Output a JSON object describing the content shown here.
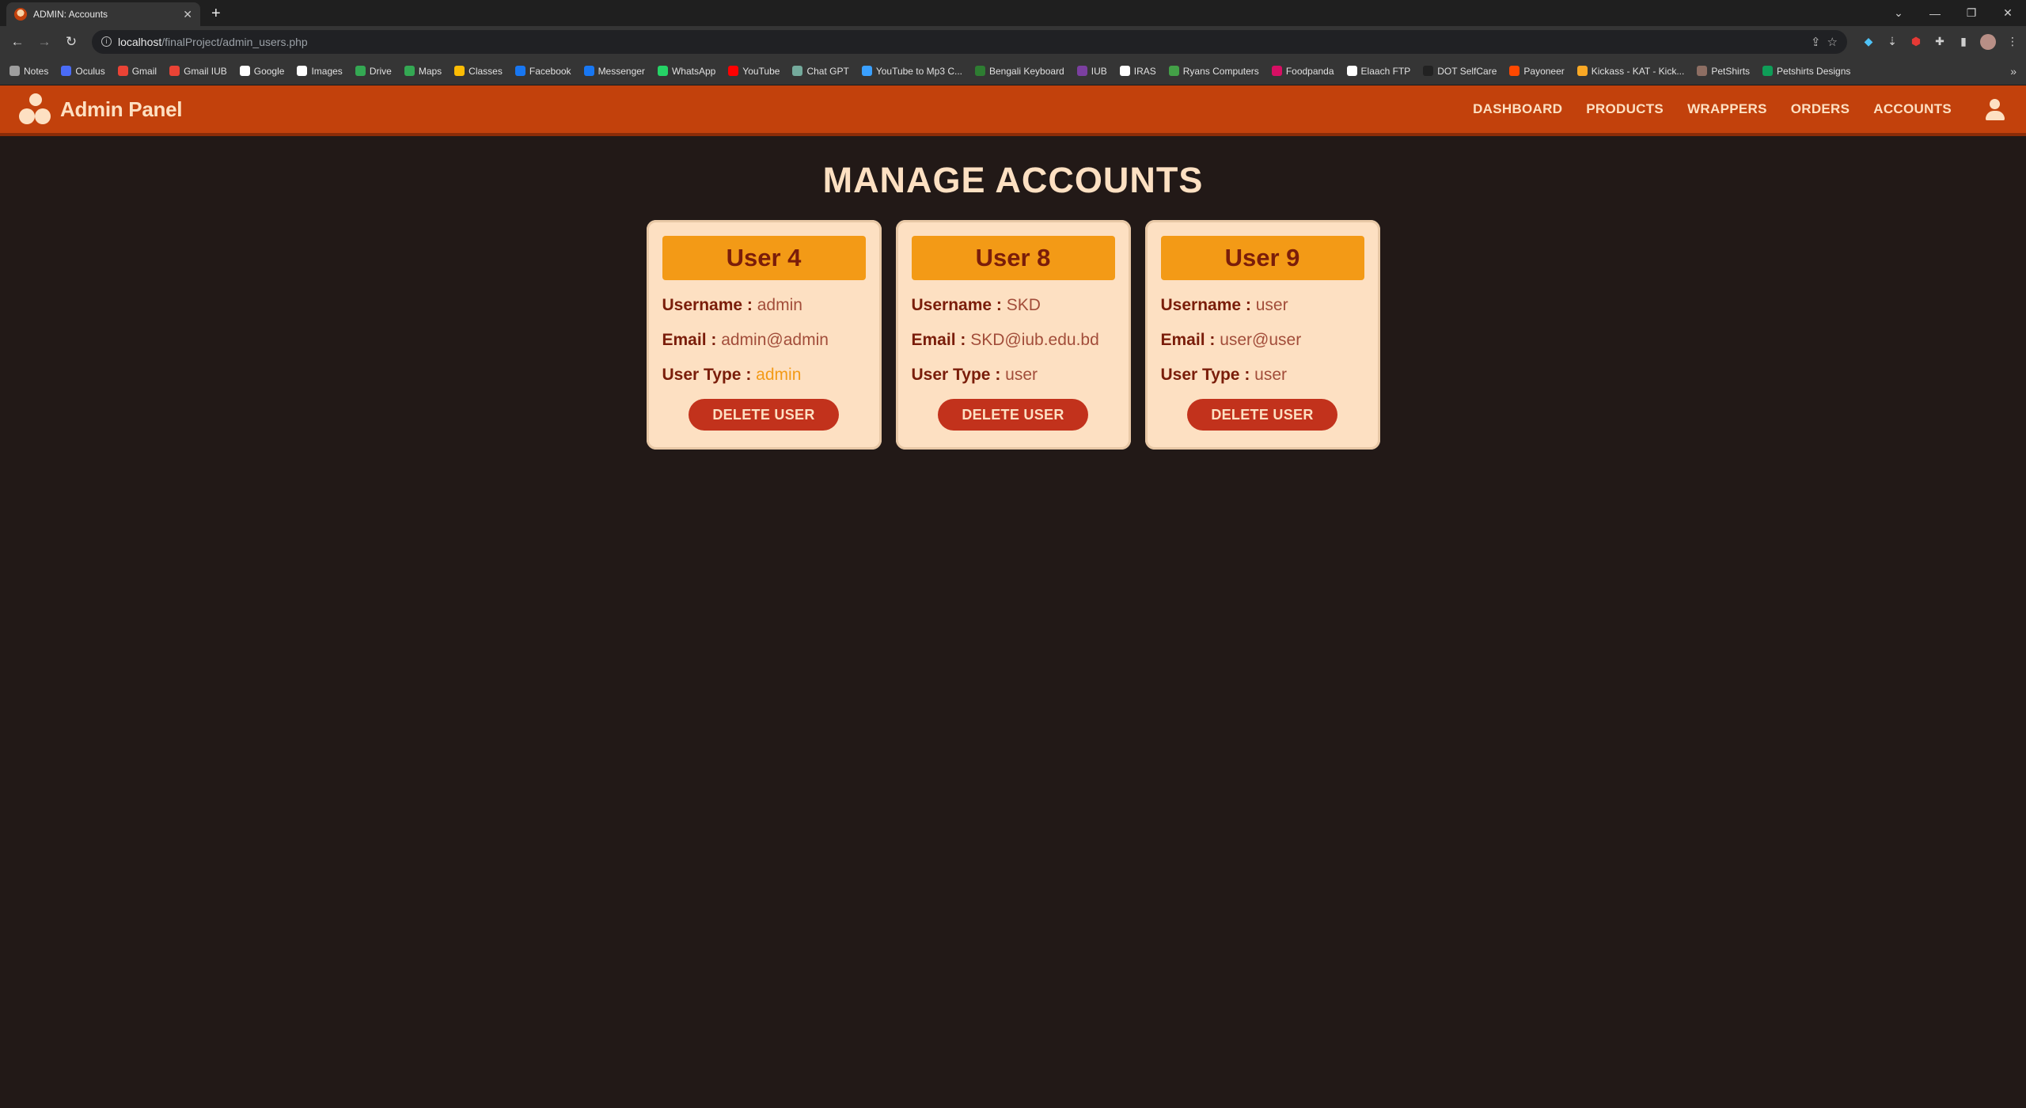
{
  "browser": {
    "tab_title": "ADMIN: Accounts",
    "url_host": "localhost",
    "url_path": "/finalProject/admin_users.php",
    "bookmarks": [
      {
        "label": "Notes",
        "color": "#9e9e9e"
      },
      {
        "label": "Oculus",
        "color": "#4a6cf7"
      },
      {
        "label": "Gmail",
        "color": "#ea4335"
      },
      {
        "label": "Gmail IUB",
        "color": "#ea4335"
      },
      {
        "label": "Google",
        "color": "#ffffff"
      },
      {
        "label": "Images",
        "color": "#ffffff"
      },
      {
        "label": "Drive",
        "color": "#34a853"
      },
      {
        "label": "Maps",
        "color": "#34a853"
      },
      {
        "label": "Classes",
        "color": "#fbbc04"
      },
      {
        "label": "Facebook",
        "color": "#1877f2"
      },
      {
        "label": "Messenger",
        "color": "#1877f2"
      },
      {
        "label": "WhatsApp",
        "color": "#25d366"
      },
      {
        "label": "YouTube",
        "color": "#ff0000"
      },
      {
        "label": "Chat GPT",
        "color": "#74aa9c"
      },
      {
        "label": "YouTube to Mp3 C...",
        "color": "#3aa0ff"
      },
      {
        "label": "Bengali Keyboard",
        "color": "#2e7d32"
      },
      {
        "label": "IUB",
        "color": "#7b3fa0"
      },
      {
        "label": "IRAS",
        "color": "#ffffff"
      },
      {
        "label": "Ryans Computers",
        "color": "#43a047"
      },
      {
        "label": "Foodpanda",
        "color": "#d70f64"
      },
      {
        "label": "Elaach FTP",
        "color": "#ffffff"
      },
      {
        "label": "DOT SelfCare",
        "color": "#222222"
      },
      {
        "label": "Payoneer",
        "color": "#ff4800"
      },
      {
        "label": "Kickass - KAT - Kick...",
        "color": "#f9a825"
      },
      {
        "label": "PetShirts",
        "color": "#8d6e63"
      },
      {
        "label": "Petshirts Designs",
        "color": "#0f9d58"
      }
    ]
  },
  "header": {
    "brand": "Admin Panel",
    "nav": [
      "DASHBOARD",
      "PRODUCTS",
      "WRAPPERS",
      "ORDERS",
      "ACCOUNTS"
    ]
  },
  "main": {
    "title": "MANAGE ACCOUNTS",
    "labels": {
      "username": "Username :",
      "email": "Email :",
      "user_type": "User Type :"
    },
    "delete_label": "DELETE USER",
    "users": [
      {
        "heading": "User 4",
        "username": "admin",
        "email": "admin@admin",
        "user_type": "admin"
      },
      {
        "heading": "User 8",
        "username": "SKD",
        "email": "SKD@iub.edu.bd",
        "user_type": "user"
      },
      {
        "heading": "User 9",
        "username": "user",
        "email": "user@user",
        "user_type": "user"
      }
    ]
  },
  "colors": {
    "header_bg": "#c2410c",
    "page_bg": "#221917",
    "card_bg": "#fde0c2",
    "card_heading_bg": "#f39a16",
    "delete_button_bg": "#c2321c"
  }
}
